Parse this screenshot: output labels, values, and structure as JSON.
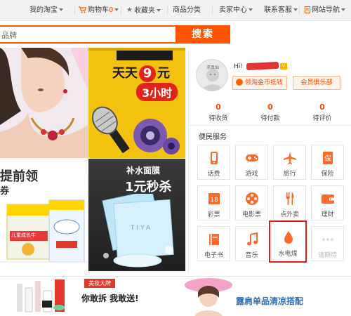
{
  "topnav": {
    "my_taobao": "我的淘宝",
    "cart_label": "购物车",
    "cart_count": "0",
    "favorites": "收藏夹",
    "categories": "商品分类",
    "seller_center": "卖家中心",
    "customer_service": "联系客服",
    "site_nav": "网站导航"
  },
  "search": {
    "placeholder": "品牌",
    "button": "搜索"
  },
  "banners": {
    "b_line1": "天天",
    "b_nine": "9",
    "b_yuan": "元",
    "b_line2": "3小时",
    "c_line1": "提前领",
    "c_line2": "券",
    "c_box_text": "儿童成长牛",
    "d_line1": "补水面膜",
    "d_line2": "1元秒杀",
    "d_brand": "TIYA",
    "strip_tag": "美妆大牌",
    "strip_text": "你敢拆 我敢送!",
    "strip_right": "露肩单品清凉搭配"
  },
  "user_panel": {
    "avatar_label": "求真仙",
    "greeting": "Hi!",
    "coins_button": "领淘金币抵钱",
    "club_button": "会员俱乐部",
    "stats": [
      {
        "value": "0",
        "label": "待收货"
      },
      {
        "value": "0",
        "label": "待付款"
      },
      {
        "value": "0",
        "label": "待评价"
      }
    ],
    "section_title": "便民服务",
    "services": [
      {
        "label": "话费",
        "icon": "phone-icon"
      },
      {
        "label": "游戏",
        "icon": "gamepad-icon"
      },
      {
        "label": "旅行",
        "icon": "plane-icon"
      },
      {
        "label": "保险",
        "icon": "insurance-icon"
      },
      {
        "label": "彩票",
        "icon": "lottery-icon"
      },
      {
        "label": "电影票",
        "icon": "film-reel-icon"
      },
      {
        "label": "点外卖",
        "icon": "fork-knife-icon"
      },
      {
        "label": "理财",
        "icon": "wallet-icon"
      },
      {
        "label": "电子书",
        "icon": "book-icon"
      },
      {
        "label": "音乐",
        "icon": "music-note-icon"
      },
      {
        "label": "水电煤",
        "icon": "water-drop-icon"
      },
      {
        "label": "请期待",
        "icon": "more-dots-icon"
      }
    ]
  },
  "colors": {
    "accent": "#ff5500",
    "tile_icon": "#ff6a2a",
    "highlight_border": "#d91c1c"
  }
}
